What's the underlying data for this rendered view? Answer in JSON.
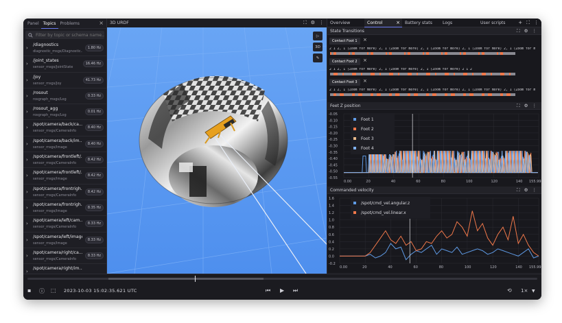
{
  "sidebar": {
    "tabs": [
      "Panel",
      "Topics",
      "Problems"
    ],
    "active_tab": "Topics",
    "filter_placeholder": "Filter by topic or schema name...",
    "topics": [
      {
        "name": "/diagnostics",
        "type": "diagnostic_msgs/Diagnostic...",
        "hz": "1.80 Hz"
      },
      {
        "name": "/joint_states",
        "type": "sensor_msgs/JointState",
        "hz": "16.46 Hz"
      },
      {
        "name": "/joy",
        "type": "sensor_msgs/Joy",
        "hz": "41.73 Hz"
      },
      {
        "name": "/rosout",
        "type": "rosgraph_msgs/Log",
        "hz": "0.33 Hz"
      },
      {
        "name": "/rosout_agg",
        "type": "rosgraph_msgs/Log",
        "hz": "0.01 Hz"
      },
      {
        "name": "/spot/camera/back/ca...",
        "type": "sensor_msgs/CameraInfo",
        "hz": "8.40 Hz"
      },
      {
        "name": "/spot/camera/back/im...",
        "type": "sensor_msgs/Image",
        "hz": "8.40 Hz"
      },
      {
        "name": "/spot/camera/frontleft/...",
        "type": "sensor_msgs/CameraInfo",
        "hz": "8.42 Hz"
      },
      {
        "name": "/spot/camera/frontleft/...",
        "type": "sensor_msgs/Image",
        "hz": "8.42 Hz"
      },
      {
        "name": "/spot/camera/frontrigh...",
        "type": "sensor_msgs/CameraInfo",
        "hz": "8.42 Hz"
      },
      {
        "name": "/spot/camera/frontrigh...",
        "type": "sensor_msgs/Image",
        "hz": "8.35 Hz"
      },
      {
        "name": "/spot/camera/left/cam...",
        "type": "sensor_msgs/CameraInfo",
        "hz": "8.33 Hz"
      },
      {
        "name": "/spot/camera/left/image",
        "type": "sensor_msgs/Image",
        "hz": "8.33 Hz"
      },
      {
        "name": "/spot/camera/right/ca...",
        "type": "sensor_msgs/CameraInfo",
        "hz": "8.33 Hz"
      },
      {
        "name": "/spot/camera/right/im...",
        "type": "",
        "hz": ""
      }
    ]
  },
  "viewport": {
    "title": "3D URDF",
    "tool_label": "3D"
  },
  "right_tabs": [
    "Overview",
    "Control",
    "Battery stats",
    "Logs",
    "User scripts"
  ],
  "right_active_tab": "Control",
  "state_transitions": {
    "title": "State Transitions",
    "rows": [
      {
        "label": "Contact Foot 1",
        "text": "2   1   2, 1 (Zoom for more)  2, 1 (Zoom for more)  2, 1 (Zoom for more)  2, 1 (Zoom for more)  2, 1 (Zoom for m"
      },
      {
        "label": "Contact Foot 2",
        "text": "2   1   2, 1 (Zoom for more)  2, 1 (Zoom for more)  2, 1 (Zoom for more)   2   1   2"
      },
      {
        "label": "Contact Foot 3",
        "text": "2   1   2, 1 (Zoom for more)  2, 1 (Zoom for more)  2, 1 (Zoom for more)  2, 1 (Zoom for more)  2, 1 (Zoom for m"
      }
    ]
  },
  "colors": {
    "blue": "#5f9be6",
    "orange": "#f0784a",
    "tan": "#e8b98a",
    "lightblue": "#7fb1f2",
    "gray": "#8a8a92"
  },
  "feet_chart": {
    "title": "Feet Z position",
    "chart_data": {
      "type": "line",
      "xlim": [
        0,
        155.99
      ],
      "ylim": [
        -0.55,
        -0.05
      ],
      "x_ticks": [
        "0.00",
        "20",
        "40",
        "60",
        "80",
        "100",
        "120",
        "140",
        "155.99"
      ],
      "y_ticks": [
        "-0.05",
        "-0.10",
        "-0.15",
        "-0.20",
        "-0.25",
        "-0.30",
        "-0.35",
        "-0.40",
        "-0.45",
        "-0.50",
        "-0.55"
      ],
      "series": [
        {
          "name": "Foot 1",
          "color": "#5f9be6"
        },
        {
          "name": "Foot 2",
          "color": "#f0784a"
        },
        {
          "name": "Foot 3",
          "color": "#e8b98a"
        },
        {
          "name": "Foot 4",
          "color": "#7fb1f2"
        }
      ]
    }
  },
  "velocity_chart": {
    "title": "Commanded velocity",
    "chart_data": {
      "type": "line",
      "xlim": [
        0,
        155.99
      ],
      "ylim": [
        -0.2,
        1.6
      ],
      "x_ticks": [
        "0.00",
        "20",
        "40",
        "60",
        "80",
        "100",
        "120",
        "140",
        "155.99"
      ],
      "y_ticks": [
        "1.6",
        "1.4",
        "1.2",
        "1.0",
        "0.8",
        "0.6",
        "0.4",
        "0.2",
        "0.0",
        "-0.2"
      ],
      "series": [
        {
          "name": "/spot/cmd_vel.angular.z",
          "color": "#5f9be6",
          "x": [
            0,
            10,
            20,
            24,
            28,
            32,
            36,
            40,
            44,
            48,
            52,
            56,
            60,
            64,
            68,
            72,
            76,
            80,
            84,
            88,
            92,
            96,
            100,
            104,
            108,
            112,
            116,
            120,
            124,
            128,
            132,
            136,
            140,
            144,
            148,
            152,
            155.99
          ],
          "y": [
            0,
            0,
            0,
            0.05,
            -0.05,
            0,
            0.1,
            0.35,
            0.2,
            0.25,
            -0.1,
            0.05,
            0.15,
            0.1,
            0.2,
            0.3,
            0.05,
            0.2,
            0.15,
            0.1,
            0.25,
            0.05,
            0.1,
            0.15,
            0.2,
            0.15,
            0.05,
            0.1,
            0.2,
            0.15,
            0.1,
            0.05,
            0,
            0.1,
            0.2,
            -0.05,
            0
          ]
        },
        {
          "name": "/spot/cmd_vel.linear.x",
          "color": "#f0784a",
          "x": [
            0,
            10,
            20,
            24,
            28,
            32,
            36,
            40,
            44,
            48,
            52,
            56,
            60,
            64,
            68,
            72,
            76,
            80,
            84,
            88,
            92,
            96,
            100,
            104,
            108,
            112,
            116,
            120,
            124,
            128,
            132,
            136,
            140,
            144,
            148,
            152,
            155.99
          ],
          "y": [
            0,
            0,
            0,
            0.1,
            0.3,
            0.5,
            0.7,
            0.45,
            0.35,
            0.55,
            0.3,
            0.4,
            0.15,
            0.2,
            0.4,
            0.35,
            0.55,
            0.7,
            0.5,
            0.6,
            0.95,
            0.8,
            0.55,
            1.25,
            0.7,
            0.9,
            0.5,
            0.3,
            0.6,
            0.8,
            0.45,
            1.1,
            0.35,
            0.6,
            0.3,
            0.1,
            0
          ]
        }
      ]
    }
  },
  "playback": {
    "timestamp": "2023-10-03 15:02:35.621 UTC",
    "speed": "1×"
  }
}
